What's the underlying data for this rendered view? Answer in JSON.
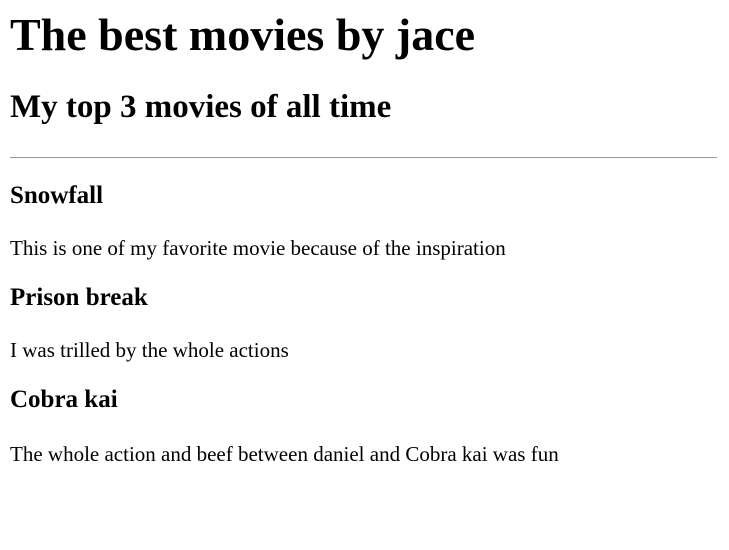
{
  "page": {
    "title": "The best movies by jace",
    "subtitle": "My top 3 movies of all time"
  },
  "movies": [
    {
      "title": "Snowfall",
      "description": "This is one of my favorite movie because of the inspiration"
    },
    {
      "title": "Prison break",
      "description": "I was trilled by the whole actions"
    },
    {
      "title": "Cobra kai",
      "description": "The whole action and beef between daniel and Cobra kai was fun"
    }
  ]
}
